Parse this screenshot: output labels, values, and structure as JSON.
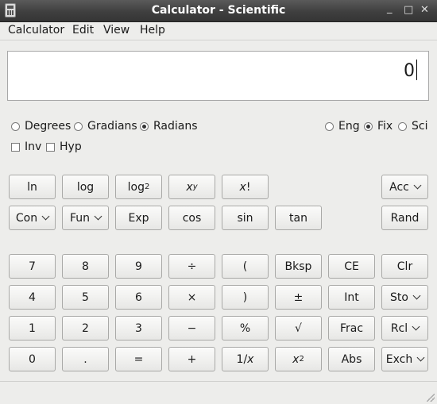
{
  "window": {
    "title": "Calculator - Scientific",
    "minimize": "_",
    "maximize": "□",
    "close": "✕"
  },
  "menu": {
    "calculator": "Calculator",
    "edit": "Edit",
    "view": "View",
    "help": "Help"
  },
  "display": {
    "value": "0"
  },
  "angle_units": {
    "degrees": "Degrees",
    "gradians": "Gradians",
    "radians": "Radians",
    "selected": "radians"
  },
  "display_mode": {
    "eng": "Eng",
    "fix": "Fix",
    "sci": "Sci",
    "selected": "fix"
  },
  "modifiers": {
    "inv": "Inv",
    "hyp": "Hyp"
  },
  "buttons": {
    "ln": "ln",
    "log": "log",
    "log2_base": "log",
    "log2_sub": "2",
    "xy_base": "x",
    "xy_sup": "y",
    "xfact_x": "x",
    "xfact_bang": "!",
    "acc": "Acc",
    "con": "Con",
    "fun": "Fun",
    "exp": "Exp",
    "cos": "cos",
    "sin": "sin",
    "tan": "tan",
    "rand": "Rand",
    "d7": "7",
    "d8": "8",
    "d9": "9",
    "div": "÷",
    "lparen": "(",
    "bksp": "Bksp",
    "ce": "CE",
    "clr": "Clr",
    "d4": "4",
    "d5": "5",
    "d6": "6",
    "mul": "×",
    "rparen": ")",
    "plusminus": "±",
    "int": "Int",
    "sto": "Sto",
    "d1": "1",
    "d2": "2",
    "d3": "3",
    "minus": "−",
    "percent": "%",
    "sqrt": "√",
    "frac": "Frac",
    "rcl": "Rcl",
    "d0": "0",
    "dot": ".",
    "eq": "=",
    "plus": "+",
    "recip_1": "1/",
    "recip_x": "x",
    "x2_base": "x",
    "x2_sup": "2",
    "abs": "Abs",
    "exch": "Exch"
  },
  "statusbar": {
    "text": ""
  }
}
